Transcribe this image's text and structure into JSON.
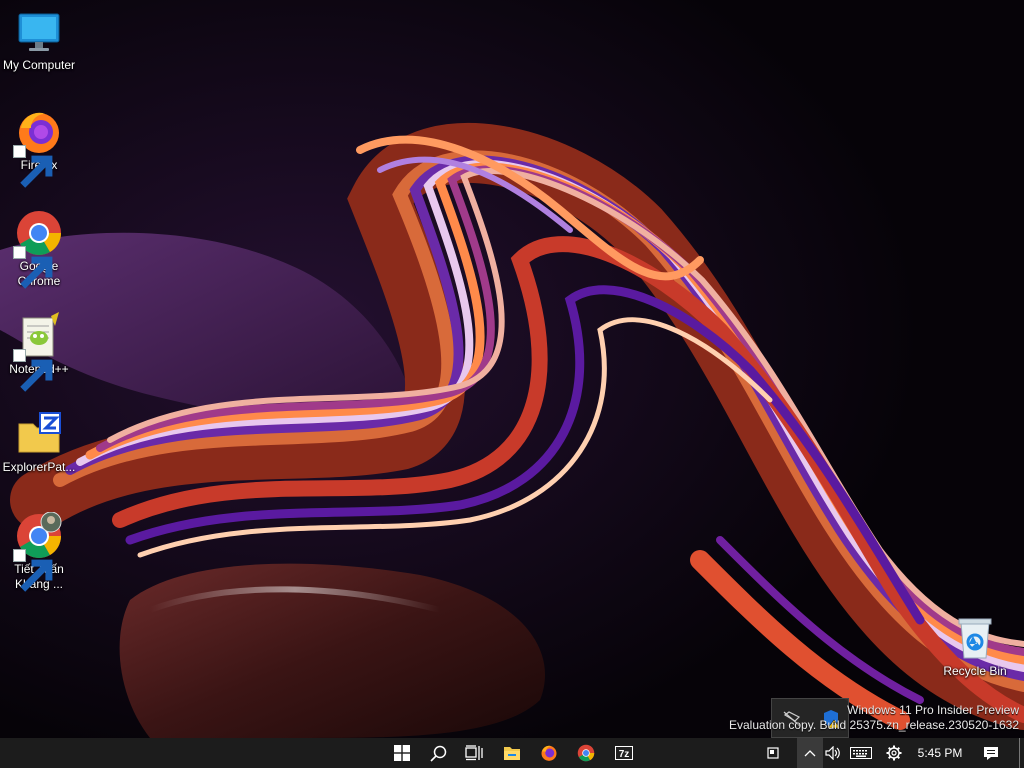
{
  "desktop": {
    "icons": [
      {
        "label": "My Computer",
        "icon": "monitor-icon"
      },
      {
        "label": "Firefox",
        "icon": "firefox-icon"
      },
      {
        "label": "Google Chrome",
        "icon": "chrome-icon"
      },
      {
        "label": "Notepad++",
        "icon": "notepadpp-icon"
      },
      {
        "label": "ExplorerPat...",
        "icon": "explorerpatcher-icon"
      },
      {
        "label": "Tiết Tuấn Khang ...",
        "icon": "chrome-profile-icon"
      },
      {
        "label": "Recycle Bin",
        "icon": "recycle-bin-icon"
      }
    ]
  },
  "watermark": {
    "line1": "Windows 11 Pro Insider Preview",
    "line2": "Evaluation copy. Build 25375.zn_release.230520-1632"
  },
  "taskbar": {
    "clock": "5:45 PM",
    "buttons": [
      "start-icon",
      "search-icon",
      "task-view-icon",
      "file-explorer-icon",
      "firefox-icon",
      "chrome-icon",
      "7zip-icon"
    ],
    "seven_zip_label": "7z",
    "tray": [
      "tablet-icon",
      "show-hidden-icons-chevron",
      "volume-icon",
      "keyboard-icon",
      "settings-gear-icon",
      "notifications-icon"
    ]
  },
  "colors": {
    "taskbar_bg": "#1c1c1c",
    "wallpaper_bg": "#07040a"
  }
}
